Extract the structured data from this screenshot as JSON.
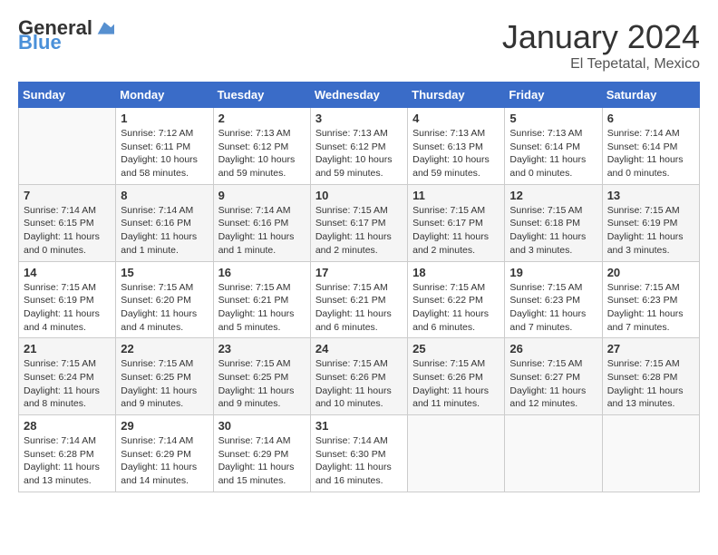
{
  "logo": {
    "general": "General",
    "blue": "Blue"
  },
  "title": "January 2024",
  "location": "El Tepetatal, Mexico",
  "days_header": [
    "Sunday",
    "Monday",
    "Tuesday",
    "Wednesday",
    "Thursday",
    "Friday",
    "Saturday"
  ],
  "weeks": [
    [
      {
        "day": "",
        "info": ""
      },
      {
        "day": "1",
        "info": "Sunrise: 7:12 AM\nSunset: 6:11 PM\nDaylight: 10 hours\nand 58 minutes."
      },
      {
        "day": "2",
        "info": "Sunrise: 7:13 AM\nSunset: 6:12 PM\nDaylight: 10 hours\nand 59 minutes."
      },
      {
        "day": "3",
        "info": "Sunrise: 7:13 AM\nSunset: 6:12 PM\nDaylight: 10 hours\nand 59 minutes."
      },
      {
        "day": "4",
        "info": "Sunrise: 7:13 AM\nSunset: 6:13 PM\nDaylight: 10 hours\nand 59 minutes."
      },
      {
        "day": "5",
        "info": "Sunrise: 7:13 AM\nSunset: 6:14 PM\nDaylight: 11 hours\nand 0 minutes."
      },
      {
        "day": "6",
        "info": "Sunrise: 7:14 AM\nSunset: 6:14 PM\nDaylight: 11 hours\nand 0 minutes."
      }
    ],
    [
      {
        "day": "7",
        "info": "Sunrise: 7:14 AM\nSunset: 6:15 PM\nDaylight: 11 hours\nand 0 minutes."
      },
      {
        "day": "8",
        "info": "Sunrise: 7:14 AM\nSunset: 6:16 PM\nDaylight: 11 hours\nand 1 minute."
      },
      {
        "day": "9",
        "info": "Sunrise: 7:14 AM\nSunset: 6:16 PM\nDaylight: 11 hours\nand 1 minute."
      },
      {
        "day": "10",
        "info": "Sunrise: 7:15 AM\nSunset: 6:17 PM\nDaylight: 11 hours\nand 2 minutes."
      },
      {
        "day": "11",
        "info": "Sunrise: 7:15 AM\nSunset: 6:17 PM\nDaylight: 11 hours\nand 2 minutes."
      },
      {
        "day": "12",
        "info": "Sunrise: 7:15 AM\nSunset: 6:18 PM\nDaylight: 11 hours\nand 3 minutes."
      },
      {
        "day": "13",
        "info": "Sunrise: 7:15 AM\nSunset: 6:19 PM\nDaylight: 11 hours\nand 3 minutes."
      }
    ],
    [
      {
        "day": "14",
        "info": "Sunrise: 7:15 AM\nSunset: 6:19 PM\nDaylight: 11 hours\nand 4 minutes."
      },
      {
        "day": "15",
        "info": "Sunrise: 7:15 AM\nSunset: 6:20 PM\nDaylight: 11 hours\nand 4 minutes."
      },
      {
        "day": "16",
        "info": "Sunrise: 7:15 AM\nSunset: 6:21 PM\nDaylight: 11 hours\nand 5 minutes."
      },
      {
        "day": "17",
        "info": "Sunrise: 7:15 AM\nSunset: 6:21 PM\nDaylight: 11 hours\nand 6 minutes."
      },
      {
        "day": "18",
        "info": "Sunrise: 7:15 AM\nSunset: 6:22 PM\nDaylight: 11 hours\nand 6 minutes."
      },
      {
        "day": "19",
        "info": "Sunrise: 7:15 AM\nSunset: 6:23 PM\nDaylight: 11 hours\nand 7 minutes."
      },
      {
        "day": "20",
        "info": "Sunrise: 7:15 AM\nSunset: 6:23 PM\nDaylight: 11 hours\nand 7 minutes."
      }
    ],
    [
      {
        "day": "21",
        "info": "Sunrise: 7:15 AM\nSunset: 6:24 PM\nDaylight: 11 hours\nand 8 minutes."
      },
      {
        "day": "22",
        "info": "Sunrise: 7:15 AM\nSunset: 6:25 PM\nDaylight: 11 hours\nand 9 minutes."
      },
      {
        "day": "23",
        "info": "Sunrise: 7:15 AM\nSunset: 6:25 PM\nDaylight: 11 hours\nand 9 minutes."
      },
      {
        "day": "24",
        "info": "Sunrise: 7:15 AM\nSunset: 6:26 PM\nDaylight: 11 hours\nand 10 minutes."
      },
      {
        "day": "25",
        "info": "Sunrise: 7:15 AM\nSunset: 6:26 PM\nDaylight: 11 hours\nand 11 minutes."
      },
      {
        "day": "26",
        "info": "Sunrise: 7:15 AM\nSunset: 6:27 PM\nDaylight: 11 hours\nand 12 minutes."
      },
      {
        "day": "27",
        "info": "Sunrise: 7:15 AM\nSunset: 6:28 PM\nDaylight: 11 hours\nand 13 minutes."
      }
    ],
    [
      {
        "day": "28",
        "info": "Sunrise: 7:14 AM\nSunset: 6:28 PM\nDaylight: 11 hours\nand 13 minutes."
      },
      {
        "day": "29",
        "info": "Sunrise: 7:14 AM\nSunset: 6:29 PM\nDaylight: 11 hours\nand 14 minutes."
      },
      {
        "day": "30",
        "info": "Sunrise: 7:14 AM\nSunset: 6:29 PM\nDaylight: 11 hours\nand 15 minutes."
      },
      {
        "day": "31",
        "info": "Sunrise: 7:14 AM\nSunset: 6:30 PM\nDaylight: 11 hours\nand 16 minutes."
      },
      {
        "day": "",
        "info": ""
      },
      {
        "day": "",
        "info": ""
      },
      {
        "day": "",
        "info": ""
      }
    ]
  ]
}
